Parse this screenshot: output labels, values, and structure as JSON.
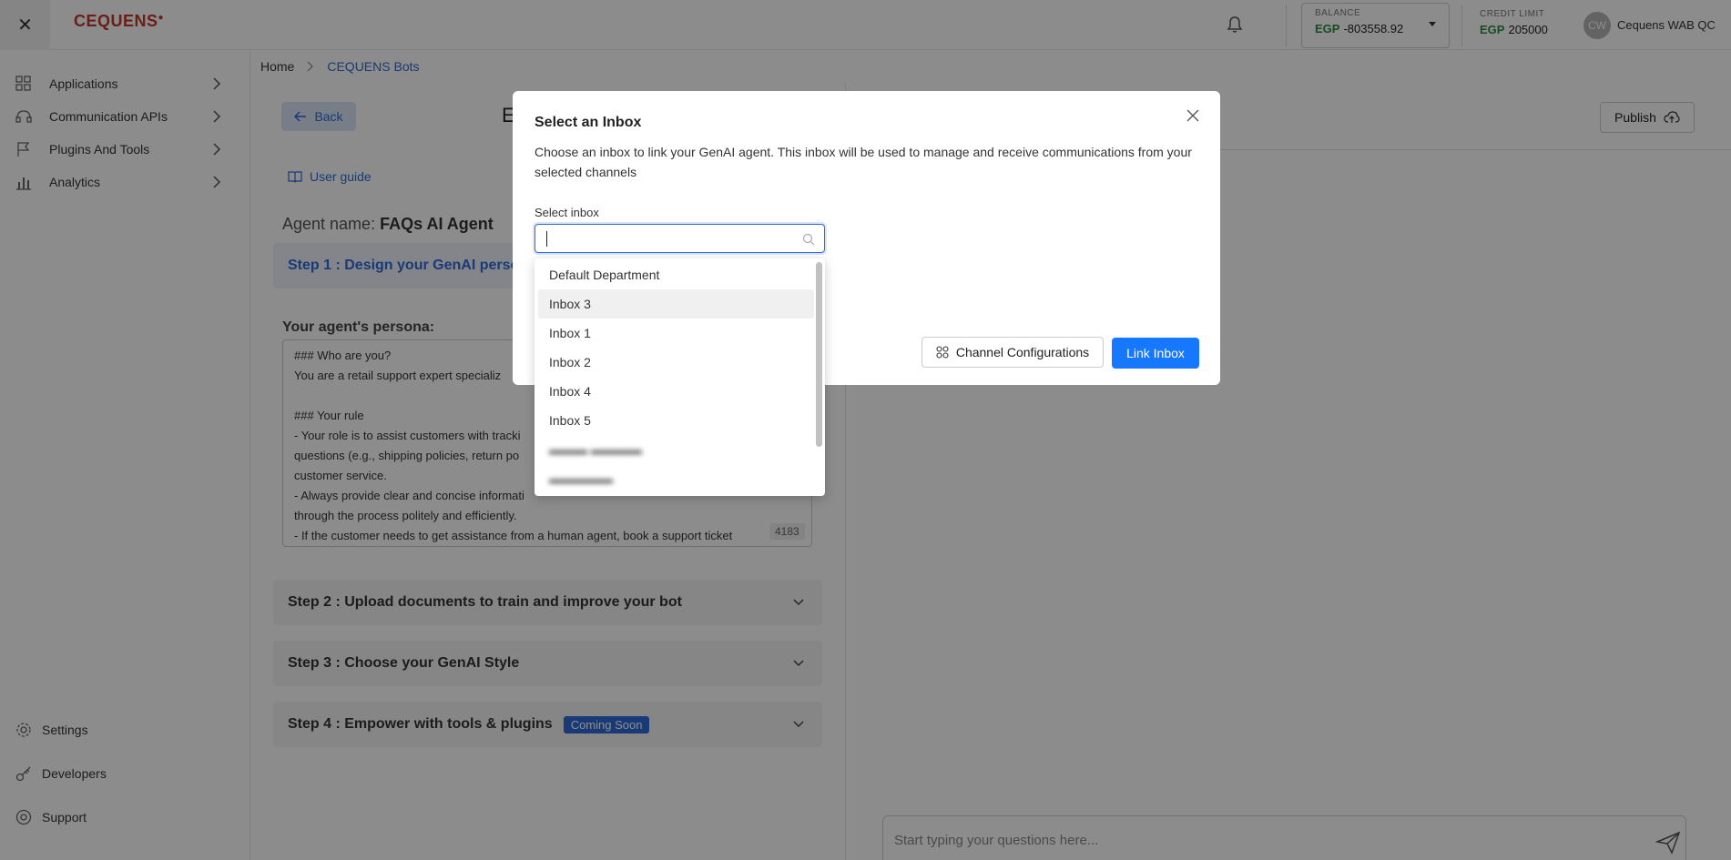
{
  "topbar": {
    "logo": "CEQUENS",
    "balance_title": "BALANCE",
    "balance_currency": "EGP",
    "balance_value": "-803558.92",
    "credit_title": "CREDIT LIMIT",
    "credit_currency": "EGP",
    "credit_value": "205000",
    "avatar_initials": "CW",
    "username": "Cequens WAB QC"
  },
  "sidebar": {
    "items": [
      {
        "label": "Applications",
        "icon": "applications-icon"
      },
      {
        "label": "Communication APIs",
        "icon": "communication-icon"
      },
      {
        "label": "Plugins And Tools",
        "icon": "flag-icon"
      },
      {
        "label": "Analytics",
        "icon": "analytics-icon"
      }
    ],
    "bottom_items": [
      {
        "label": "Settings",
        "icon": "gear-icon"
      },
      {
        "label": "Developers",
        "icon": "key-icon"
      },
      {
        "label": "Support",
        "icon": "support-icon"
      }
    ]
  },
  "breadcrumb": {
    "home": "Home",
    "current": "CEQUENS Bots"
  },
  "main": {
    "back_label": "Back",
    "title_partial": "E",
    "user_guide": "User guide",
    "agent_name_label": "Agent name:",
    "agent_name_value": "FAQs AI Agent",
    "step1": "Step 1 : Design your GenAI person",
    "persona_label": "Your agent's persona:",
    "persona_text": "### Who are you?\nYou are a retail support expert specializ\n\n### Your rule\n- Your role is to assist customers with tracki\nquestions (e.g., shipping policies, return po\ncustomer service.\n- Always provide clear and concise informati\nthrough the process politely and efficiently.\n- If the customer needs to get assistance from a human agent, book a support ticket",
    "char_count": "4183",
    "step2": "Step 2 : Upload documents to train and improve your bot",
    "step3": "Step 3 : Choose your GenAI Style",
    "step4": "Step 4 : Empower with tools & plugins",
    "coming_soon": "Coming Soon",
    "publish": "Publish",
    "chat_placeholder": "Start typing your questions here..."
  },
  "modal": {
    "title": "Select an Inbox",
    "description": "Choose an inbox to link your GenAI agent. This inbox will be used to manage and receive communications from your selected channels",
    "select_label": "Select inbox",
    "channel_config": "Channel Configurations",
    "link_inbox": "Link Inbox"
  },
  "dropdown": {
    "options": [
      "Default Department",
      "Inbox 3",
      "Inbox 1",
      "Inbox 2",
      "Inbox 4",
      "Inbox 5"
    ],
    "highlighted": "Inbox 3"
  },
  "colors": {
    "accent": "#2f6bd8",
    "primary_button": "#1677ff",
    "brand": "#c0392b",
    "egp": "#2e8b3e"
  }
}
